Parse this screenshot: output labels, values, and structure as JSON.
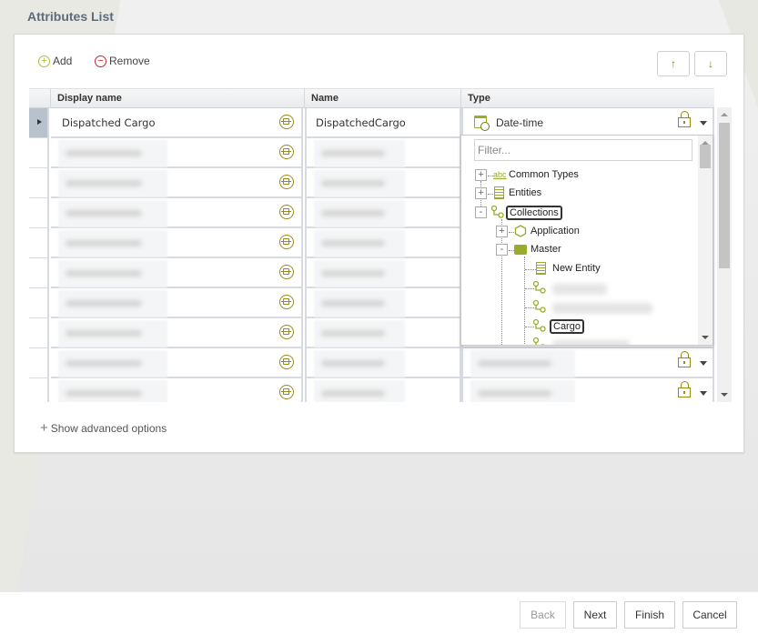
{
  "page": {
    "title": "Attributes List"
  },
  "toolbar": {
    "add_label": "Add",
    "remove_label": "Remove",
    "move_up_label": "↑",
    "move_down_label": "↓"
  },
  "grid": {
    "columns": [
      {
        "label": "Display name"
      },
      {
        "label": "Name"
      },
      {
        "label": "Type"
      }
    ],
    "rows": [
      {
        "display_name": "Dispatched Cargo",
        "name": "DispatchedCargo",
        "type": "Date-time",
        "selected": true,
        "redacted": false
      },
      {
        "display_name": "",
        "name": "",
        "type": "",
        "redacted": true
      },
      {
        "display_name": "",
        "name": "",
        "type": "",
        "redacted": true
      },
      {
        "display_name": "",
        "name": "",
        "type": "",
        "redacted": true
      },
      {
        "display_name": "",
        "name": "",
        "type": "",
        "redacted": true
      },
      {
        "display_name": "",
        "name": "",
        "type": "",
        "redacted": true
      },
      {
        "display_name": "",
        "name": "",
        "type": "",
        "redacted": true
      },
      {
        "display_name": "",
        "name": "",
        "type": "",
        "redacted": true
      },
      {
        "display_name": "",
        "name": "",
        "type": "",
        "redacted": true
      },
      {
        "display_name": "",
        "name": "",
        "type": "",
        "redacted": true
      }
    ]
  },
  "type_dropdown": {
    "filter_placeholder": "Filter...",
    "tree": [
      {
        "label": "Common Types",
        "icon": "abc-icon",
        "expander": "+"
      },
      {
        "label": "Entities",
        "icon": "entity-icon",
        "expander": "+"
      },
      {
        "label": "Collections",
        "icon": "collection-icon",
        "expander": "-",
        "focused": true,
        "children": [
          {
            "label": "Application",
            "icon": "hexagon-icon",
            "expander": "+"
          },
          {
            "label": "Master",
            "icon": "briefcase-icon",
            "expander": "-",
            "children": [
              {
                "label": "New Entity",
                "icon": "new-entity-icon"
              },
              {
                "label": "",
                "icon": "collection-icon",
                "redacted": true
              },
              {
                "label": "",
                "icon": "collection-icon",
                "redacted": true
              },
              {
                "label": "Cargo",
                "icon": "collection-icon",
                "focused": true
              },
              {
                "label": "",
                "icon": "collection-icon",
                "redacted": true
              }
            ]
          }
        ]
      }
    ]
  },
  "show_advanced_label": "Show advanced options",
  "footer": {
    "back_label": "Back",
    "next_label": "Next",
    "finish_label": "Finish",
    "cancel_label": "Cancel"
  },
  "colors": {
    "accent_green": "#a8c23a",
    "icon_olive": "#9a8a16",
    "remove_red": "#c0272d",
    "title_slate": "#5e6b7b"
  }
}
